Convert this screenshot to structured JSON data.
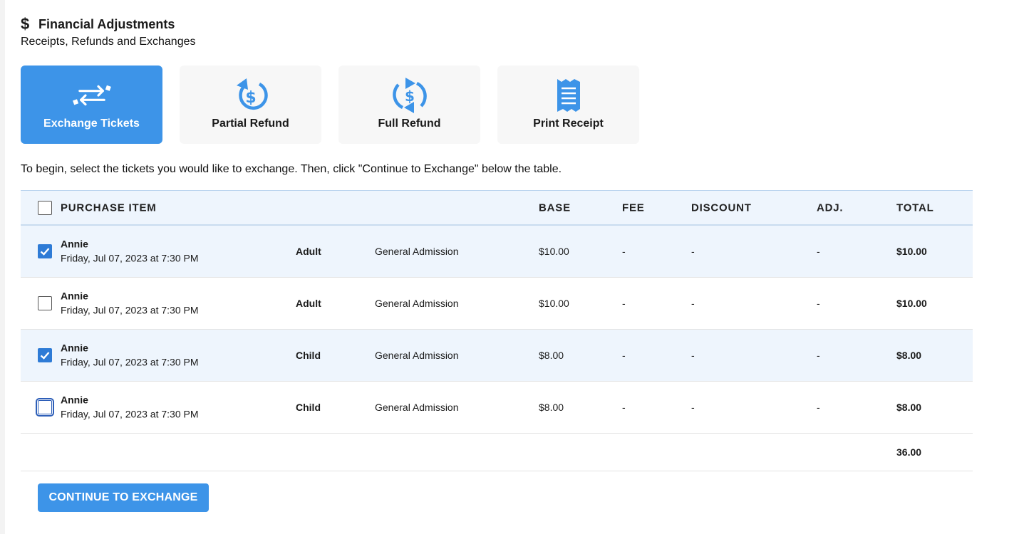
{
  "header": {
    "title": "Financial Adjustments",
    "subtitle": "Receipts, Refunds and Exchanges",
    "icon": "dollar-icon"
  },
  "actions": [
    {
      "label": "Exchange Tickets",
      "icon": "exchange-icon",
      "active": true
    },
    {
      "label": "Partial Refund",
      "icon": "partial-refund-icon",
      "active": false
    },
    {
      "label": "Full Refund",
      "icon": "full-refund-icon",
      "active": false
    },
    {
      "label": "Print Receipt",
      "icon": "receipt-icon",
      "active": false
    }
  ],
  "instructions": "To begin, select the tickets you would like to exchange. Then, click \"Continue to Exchange\" below the table.",
  "table": {
    "headers": {
      "item": "PURCHASE ITEM",
      "base": "BASE",
      "fee": "FEE",
      "discount": "DISCOUNT",
      "adj": "ADJ.",
      "total": "TOTAL"
    },
    "rows": [
      {
        "name": "Annie",
        "date": "Friday, Jul 07, 2023 at 7:30 PM",
        "type": "Adult",
        "section": "General Admission",
        "base": "$10.00",
        "fee": "-",
        "discount": "-",
        "adj": "-",
        "total": "$10.00",
        "checked": true
      },
      {
        "name": "Annie",
        "date": "Friday, Jul 07, 2023 at 7:30 PM",
        "type": "Adult",
        "section": "General Admission",
        "base": "$10.00",
        "fee": "-",
        "discount": "-",
        "adj": "-",
        "total": "$10.00",
        "checked": false
      },
      {
        "name": "Annie",
        "date": "Friday, Jul 07, 2023 at 7:30 PM",
        "type": "Child",
        "section": "General Admission",
        "base": "$8.00",
        "fee": "-",
        "discount": "-",
        "adj": "-",
        "total": "$8.00",
        "checked": true
      },
      {
        "name": "Annie",
        "date": "Friday, Jul 07, 2023 at 7:30 PM",
        "type": "Child",
        "section": "General Admission",
        "base": "$8.00",
        "fee": "-",
        "discount": "-",
        "adj": "-",
        "total": "$8.00",
        "checked": false
      }
    ],
    "grand_total": "36.00"
  },
  "continue_label": "CONTINUE TO EXCHANGE",
  "colors": {
    "accent": "#3d94e8",
    "checkbox": "#2e7bd6",
    "row_selected": "#eef5fd"
  }
}
